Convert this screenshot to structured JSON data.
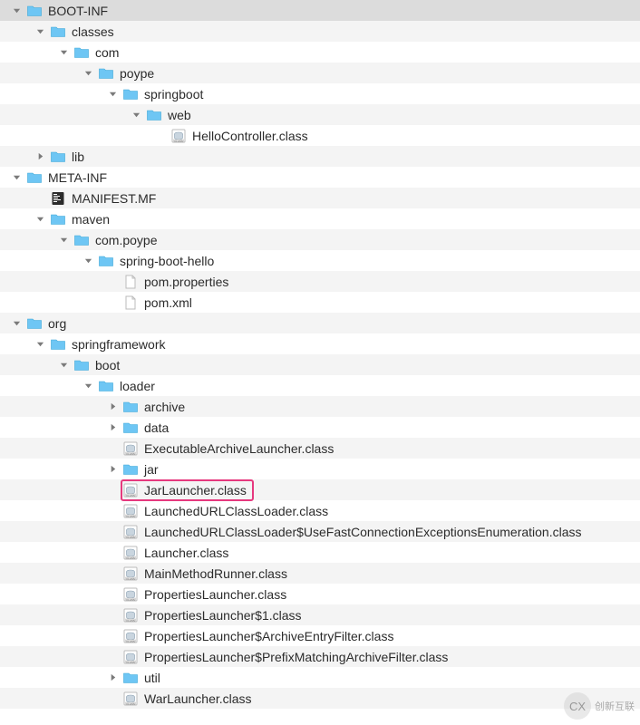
{
  "icons": {
    "folder_fill": "#6ec6f4",
    "folder_stroke": "#3aa7d8"
  },
  "rows": [
    {
      "indent": 14,
      "arrow": "down",
      "icon": "folder",
      "label": "BOOT-INF",
      "selected": true
    },
    {
      "indent": 40,
      "arrow": "down",
      "icon": "folder",
      "label": "classes"
    },
    {
      "indent": 66,
      "arrow": "down",
      "icon": "folder",
      "label": "com"
    },
    {
      "indent": 93,
      "arrow": "down",
      "icon": "folder",
      "label": "poype"
    },
    {
      "indent": 120,
      "arrow": "down",
      "icon": "folder",
      "label": "springboot"
    },
    {
      "indent": 146,
      "arrow": "down",
      "icon": "folder",
      "label": "web"
    },
    {
      "indent": 173,
      "arrow": "none",
      "icon": "class",
      "label": "HelloController.class"
    },
    {
      "indent": 40,
      "arrow": "right",
      "icon": "folder",
      "label": "lib"
    },
    {
      "indent": 14,
      "arrow": "down",
      "icon": "folder",
      "label": "META-INF"
    },
    {
      "indent": 40,
      "arrow": "none",
      "icon": "manifest",
      "label": "MANIFEST.MF"
    },
    {
      "indent": 40,
      "arrow": "down",
      "icon": "folder",
      "label": "maven"
    },
    {
      "indent": 66,
      "arrow": "down",
      "icon": "folder",
      "label": "com.poype"
    },
    {
      "indent": 93,
      "arrow": "down",
      "icon": "folder",
      "label": "spring-boot-hello"
    },
    {
      "indent": 120,
      "arrow": "none",
      "icon": "file",
      "label": "pom.properties"
    },
    {
      "indent": 120,
      "arrow": "none",
      "icon": "file",
      "label": "pom.xml"
    },
    {
      "indent": 14,
      "arrow": "down",
      "icon": "folder",
      "label": "org"
    },
    {
      "indent": 40,
      "arrow": "down",
      "icon": "folder",
      "label": "springframework"
    },
    {
      "indent": 66,
      "arrow": "down",
      "icon": "folder",
      "label": "boot"
    },
    {
      "indent": 93,
      "arrow": "down",
      "icon": "folder",
      "label": "loader"
    },
    {
      "indent": 120,
      "arrow": "right",
      "icon": "folder",
      "label": "archive"
    },
    {
      "indent": 120,
      "arrow": "right",
      "icon": "folder",
      "label": "data"
    },
    {
      "indent": 120,
      "arrow": "none",
      "icon": "class",
      "label": "ExecutableArchiveLauncher.class"
    },
    {
      "indent": 120,
      "arrow": "right",
      "icon": "folder",
      "label": "jar"
    },
    {
      "indent": 120,
      "arrow": "none",
      "icon": "class",
      "label": "JarLauncher.class",
      "highlight": true
    },
    {
      "indent": 120,
      "arrow": "none",
      "icon": "class",
      "label": "LaunchedURLClassLoader.class"
    },
    {
      "indent": 120,
      "arrow": "none",
      "icon": "class",
      "label": "LaunchedURLClassLoader$UseFastConnectionExceptionsEnumeration.class"
    },
    {
      "indent": 120,
      "arrow": "none",
      "icon": "class",
      "label": "Launcher.class"
    },
    {
      "indent": 120,
      "arrow": "none",
      "icon": "class",
      "label": "MainMethodRunner.class"
    },
    {
      "indent": 120,
      "arrow": "none",
      "icon": "class",
      "label": "PropertiesLauncher.class"
    },
    {
      "indent": 120,
      "arrow": "none",
      "icon": "class",
      "label": "PropertiesLauncher$1.class"
    },
    {
      "indent": 120,
      "arrow": "none",
      "icon": "class",
      "label": "PropertiesLauncher$ArchiveEntryFilter.class"
    },
    {
      "indent": 120,
      "arrow": "none",
      "icon": "class",
      "label": "PropertiesLauncher$PrefixMatchingArchiveFilter.class"
    },
    {
      "indent": 120,
      "arrow": "right",
      "icon": "folder",
      "label": "util"
    },
    {
      "indent": 120,
      "arrow": "none",
      "icon": "class",
      "label": "WarLauncher.class"
    }
  ],
  "watermark": "创新互联"
}
